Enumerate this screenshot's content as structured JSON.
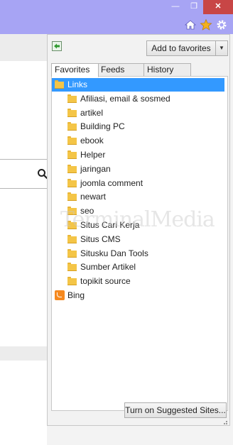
{
  "window": {
    "minimize_glyph": "—",
    "restore_glyph": "❐",
    "close_glyph": "✕"
  },
  "toolbar": {
    "icons": [
      "home-icon",
      "star-icon",
      "gear-icon"
    ],
    "star_color": "#f2b01e"
  },
  "favorites_center": {
    "add_button_label": "Add to favorites",
    "dropdown_glyph": "▼",
    "tabs": [
      {
        "label": "Favorites",
        "active": true
      },
      {
        "label": "Feeds",
        "active": false
      },
      {
        "label": "History",
        "active": false
      }
    ],
    "items": [
      {
        "label": "Links",
        "icon": "folder-icon",
        "level": 0,
        "selected": true
      },
      {
        "label": "Afiliasi, email & sosmed",
        "icon": "folder-icon",
        "level": 1,
        "selected": false
      },
      {
        "label": "artikel",
        "icon": "folder-icon",
        "level": 1,
        "selected": false
      },
      {
        "label": "Building PC",
        "icon": "folder-icon",
        "level": 1,
        "selected": false
      },
      {
        "label": "ebook",
        "icon": "folder-icon",
        "level": 1,
        "selected": false
      },
      {
        "label": "Helper",
        "icon": "folder-icon",
        "level": 1,
        "selected": false
      },
      {
        "label": "jaringan",
        "icon": "folder-icon",
        "level": 1,
        "selected": false
      },
      {
        "label": "joomla comment",
        "icon": "folder-icon",
        "level": 1,
        "selected": false
      },
      {
        "label": "newart",
        "icon": "folder-icon",
        "level": 1,
        "selected": false
      },
      {
        "label": "seo",
        "icon": "folder-icon",
        "level": 1,
        "selected": false
      },
      {
        "label": "Situs Cari Kerja",
        "icon": "folder-icon",
        "level": 1,
        "selected": false
      },
      {
        "label": "Situs CMS",
        "icon": "folder-icon",
        "level": 1,
        "selected": false
      },
      {
        "label": "Situsku Dan Tools",
        "icon": "folder-icon",
        "level": 1,
        "selected": false
      },
      {
        "label": "Sumber Artikel",
        "icon": "folder-icon",
        "level": 1,
        "selected": false
      },
      {
        "label": "topikit source",
        "icon": "folder-icon",
        "level": 1,
        "selected": false
      },
      {
        "label": "Bing",
        "icon": "bing-icon",
        "level": 0,
        "selected": false
      }
    ],
    "suggested_sites_button_label": "Turn on Suggested Sites...",
    "selection_color": "#3399ff"
  },
  "watermark": "TerminalMedia"
}
